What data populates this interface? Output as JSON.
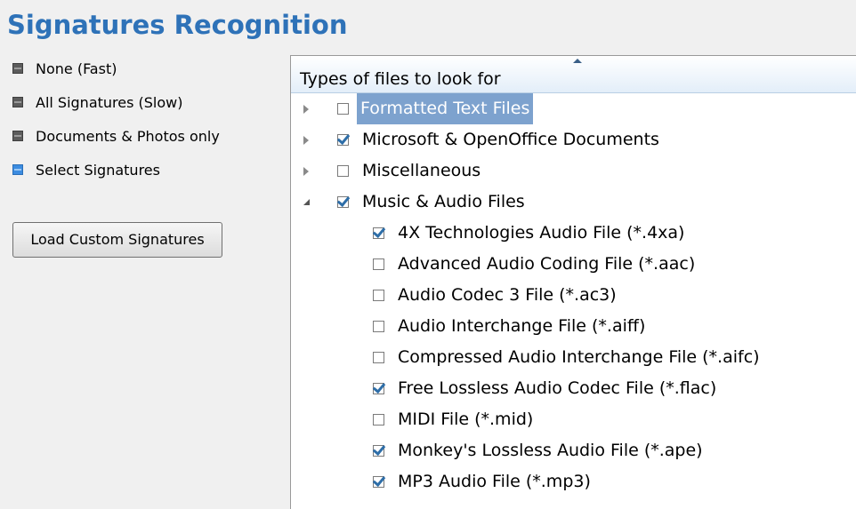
{
  "title": "Signatures Recognition",
  "options": [
    {
      "label": "None (Fast)",
      "selected": false
    },
    {
      "label": "All Signatures (Slow)",
      "selected": false
    },
    {
      "label": "Documents & Photos only",
      "selected": false
    },
    {
      "label": "Select Signatures",
      "selected": true
    }
  ],
  "load_button": "Load Custom Signatures",
  "tree": {
    "header": "Types of files to look for",
    "groups": [
      {
        "label": "Formatted Text Files",
        "checked": false,
        "expanded": false,
        "selected": true
      },
      {
        "label": "Microsoft & OpenOffice Documents",
        "checked": true,
        "expanded": false
      },
      {
        "label": "Miscellaneous",
        "checked": false,
        "expanded": false
      },
      {
        "label": "Music & Audio Files",
        "checked": true,
        "expanded": true
      }
    ],
    "children": [
      {
        "label": "4X Technologies Audio File (*.4xa)",
        "checked": true
      },
      {
        "label": "Advanced Audio Coding File (*.aac)",
        "checked": false
      },
      {
        "label": "Audio Codec 3 File (*.ac3)",
        "checked": false
      },
      {
        "label": "Audio Interchange File (*.aiff)",
        "checked": false
      },
      {
        "label": "Compressed Audio Interchange File (*.aifc)",
        "checked": false
      },
      {
        "label": "Free Lossless Audio Codec File (*.flac)",
        "checked": true
      },
      {
        "label": "MIDI File (*.mid)",
        "checked": false
      },
      {
        "label": "Monkey's Lossless Audio File (*.ape)",
        "checked": true
      },
      {
        "label": "MP3 Audio File (*.mp3)",
        "checked": true
      }
    ]
  }
}
